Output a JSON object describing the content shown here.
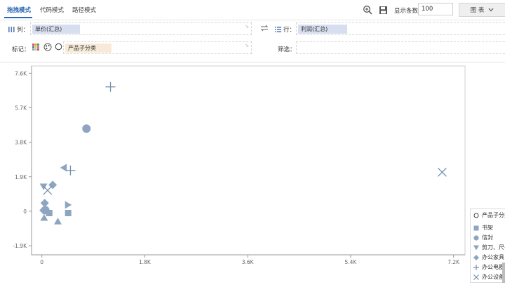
{
  "tabs": [
    {
      "label": "拖拽模式",
      "active": true
    },
    {
      "label": "代码模式",
      "active": false
    },
    {
      "label": "路径模式",
      "active": false
    }
  ],
  "toolbar": {
    "zoom_icon": "zoom-in-icon",
    "save_icon": "save-icon",
    "row_count_label": "显示条数",
    "row_count_value": "100",
    "chart_button_label": "图 表",
    "chart_button_icon": "chevron-down-icon"
  },
  "shelves": {
    "columns": {
      "label": "列：",
      "pill": "单价(汇总)"
    },
    "rows": {
      "label": "行：",
      "pill": "利润(汇总)"
    },
    "marks": {
      "label": "标记：",
      "pill": "产品子分类"
    },
    "filter": {
      "label": "筛选：",
      "pill": ""
    }
  },
  "colors": {
    "accent": "#2b67b2",
    "marker": "#8ea5c0",
    "pill_blue": "#d7deef",
    "pill_orange": "#f7ead7"
  },
  "legend": {
    "title": "产品子分类",
    "items": [
      {
        "label": "书架",
        "shape": "square"
      },
      {
        "label": "信封",
        "shape": "circle"
      },
      {
        "label": "剪刀、尺子",
        "shape": "triangle-down"
      },
      {
        "label": "办公家具",
        "shape": "diamond"
      },
      {
        "label": "办公电器",
        "shape": "plus"
      },
      {
        "label": "办公设备",
        "shape": "cross"
      }
    ]
  },
  "chart_data": {
    "type": "scatter",
    "xlabel": "",
    "ylabel": "",
    "xlim": [
      -180,
      7400
    ],
    "ylim": [
      -2400,
      8000
    ],
    "x_ticks": [
      0,
      1800,
      3600,
      5400,
      7200
    ],
    "x_tick_labels": [
      "0",
      "1.8K",
      "3.6K",
      "5.4K",
      "7.2K"
    ],
    "y_ticks": [
      -1900,
      0,
      1900,
      3800,
      5700,
      7600
    ],
    "y_tick_labels": [
      "-1.9K",
      "0",
      "1.9K",
      "3.8K",
      "5.7K",
      "7.6K"
    ],
    "grid": false,
    "legend_position": "right-bottom",
    "points": [
      {
        "x": 1200,
        "y": 6850,
        "shape": "plus"
      },
      {
        "x": 780,
        "y": 4550,
        "shape": "circle"
      },
      {
        "x": 380,
        "y": 2400,
        "shape": "triangle-left"
      },
      {
        "x": 500,
        "y": 2250,
        "shape": "plus"
      },
      {
        "x": 7000,
        "y": 2150,
        "shape": "cross"
      },
      {
        "x": 30,
        "y": 1350,
        "shape": "triangle-down"
      },
      {
        "x": 190,
        "y": 1450,
        "shape": "diamond"
      },
      {
        "x": 100,
        "y": 1150,
        "shape": "cross"
      },
      {
        "x": 50,
        "y": 450,
        "shape": "diamond"
      },
      {
        "x": 460,
        "y": 350,
        "shape": "triangle-right"
      },
      {
        "x": 30,
        "y": 50,
        "shape": "diamond"
      },
      {
        "x": 60,
        "y": 60,
        "shape": "circle"
      },
      {
        "x": 130,
        "y": -100,
        "shape": "square"
      },
      {
        "x": 460,
        "y": -100,
        "shape": "square"
      },
      {
        "x": 40,
        "y": -350,
        "shape": "triangle-up"
      },
      {
        "x": 280,
        "y": -550,
        "shape": "triangle-up"
      }
    ]
  }
}
